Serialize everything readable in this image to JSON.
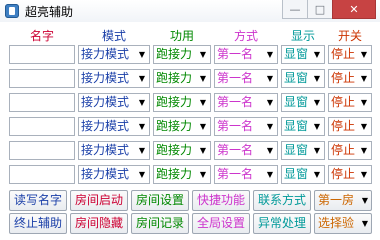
{
  "window": {
    "title": "超亮辅助",
    "controls": [
      "—",
      "□",
      "✕"
    ]
  },
  "headers": [
    {
      "label": "名字",
      "color": "#cc0033"
    },
    {
      "label": "模式",
      "color": "#1a3fa8"
    },
    {
      "label": "功用",
      "color": "#008800"
    },
    {
      "label": "方式",
      "color": "#cc33cc"
    },
    {
      "label": "显示",
      "color": "#009999"
    },
    {
      "label": "开关",
      "color": "#cc3300"
    }
  ],
  "rows": [
    {
      "name": "",
      "mode": "接力模式",
      "function": "跑接力",
      "method": "第一名",
      "display": "显窗",
      "toggle": "停止"
    },
    {
      "name": "",
      "mode": "接力模式",
      "function": "跑接力",
      "method": "第一名",
      "display": "显窗",
      "toggle": "停止"
    },
    {
      "name": "",
      "mode": "接力模式",
      "function": "跑接力",
      "method": "第一名",
      "display": "显窗",
      "toggle": "停止"
    },
    {
      "name": "",
      "mode": "接力模式",
      "function": "跑接力",
      "method": "第一名",
      "display": "显窗",
      "toggle": "停止"
    },
    {
      "name": "",
      "mode": "接力模式",
      "function": "跑接力",
      "method": "第一名",
      "display": "显窗",
      "toggle": "停止"
    },
    {
      "name": "",
      "mode": "接力模式",
      "function": "跑接力",
      "method": "第一名",
      "display": "显窗",
      "toggle": "停止"
    }
  ],
  "column_colors": {
    "mode": "#1a3fa8",
    "function": "#008800",
    "method": "#cc33cc",
    "display": "#009999",
    "toggle": "#cc3300"
  },
  "buttons_row1": [
    {
      "label": "读写名字",
      "color": "#1a3fa8"
    },
    {
      "label": "房间启动",
      "color": "#cc0033"
    },
    {
      "label": "房间设置",
      "color": "#008800"
    },
    {
      "label": "快捷功能",
      "color": "#cc33cc"
    },
    {
      "label": "联系方式",
      "color": "#009999"
    },
    {
      "label": "第一房",
      "color": "#cc6600",
      "dropdown": true
    }
  ],
  "buttons_row2": [
    {
      "label": "终止辅助",
      "color": "#1a3fa8"
    },
    {
      "label": "房间隐藏",
      "color": "#cc0033"
    },
    {
      "label": "房间记录",
      "color": "#008800"
    },
    {
      "label": "全局设置",
      "color": "#cc33cc"
    },
    {
      "label": "异常处理",
      "color": "#009999"
    },
    {
      "label": "选择验",
      "color": "#cc6600",
      "dropdown": true
    }
  ]
}
